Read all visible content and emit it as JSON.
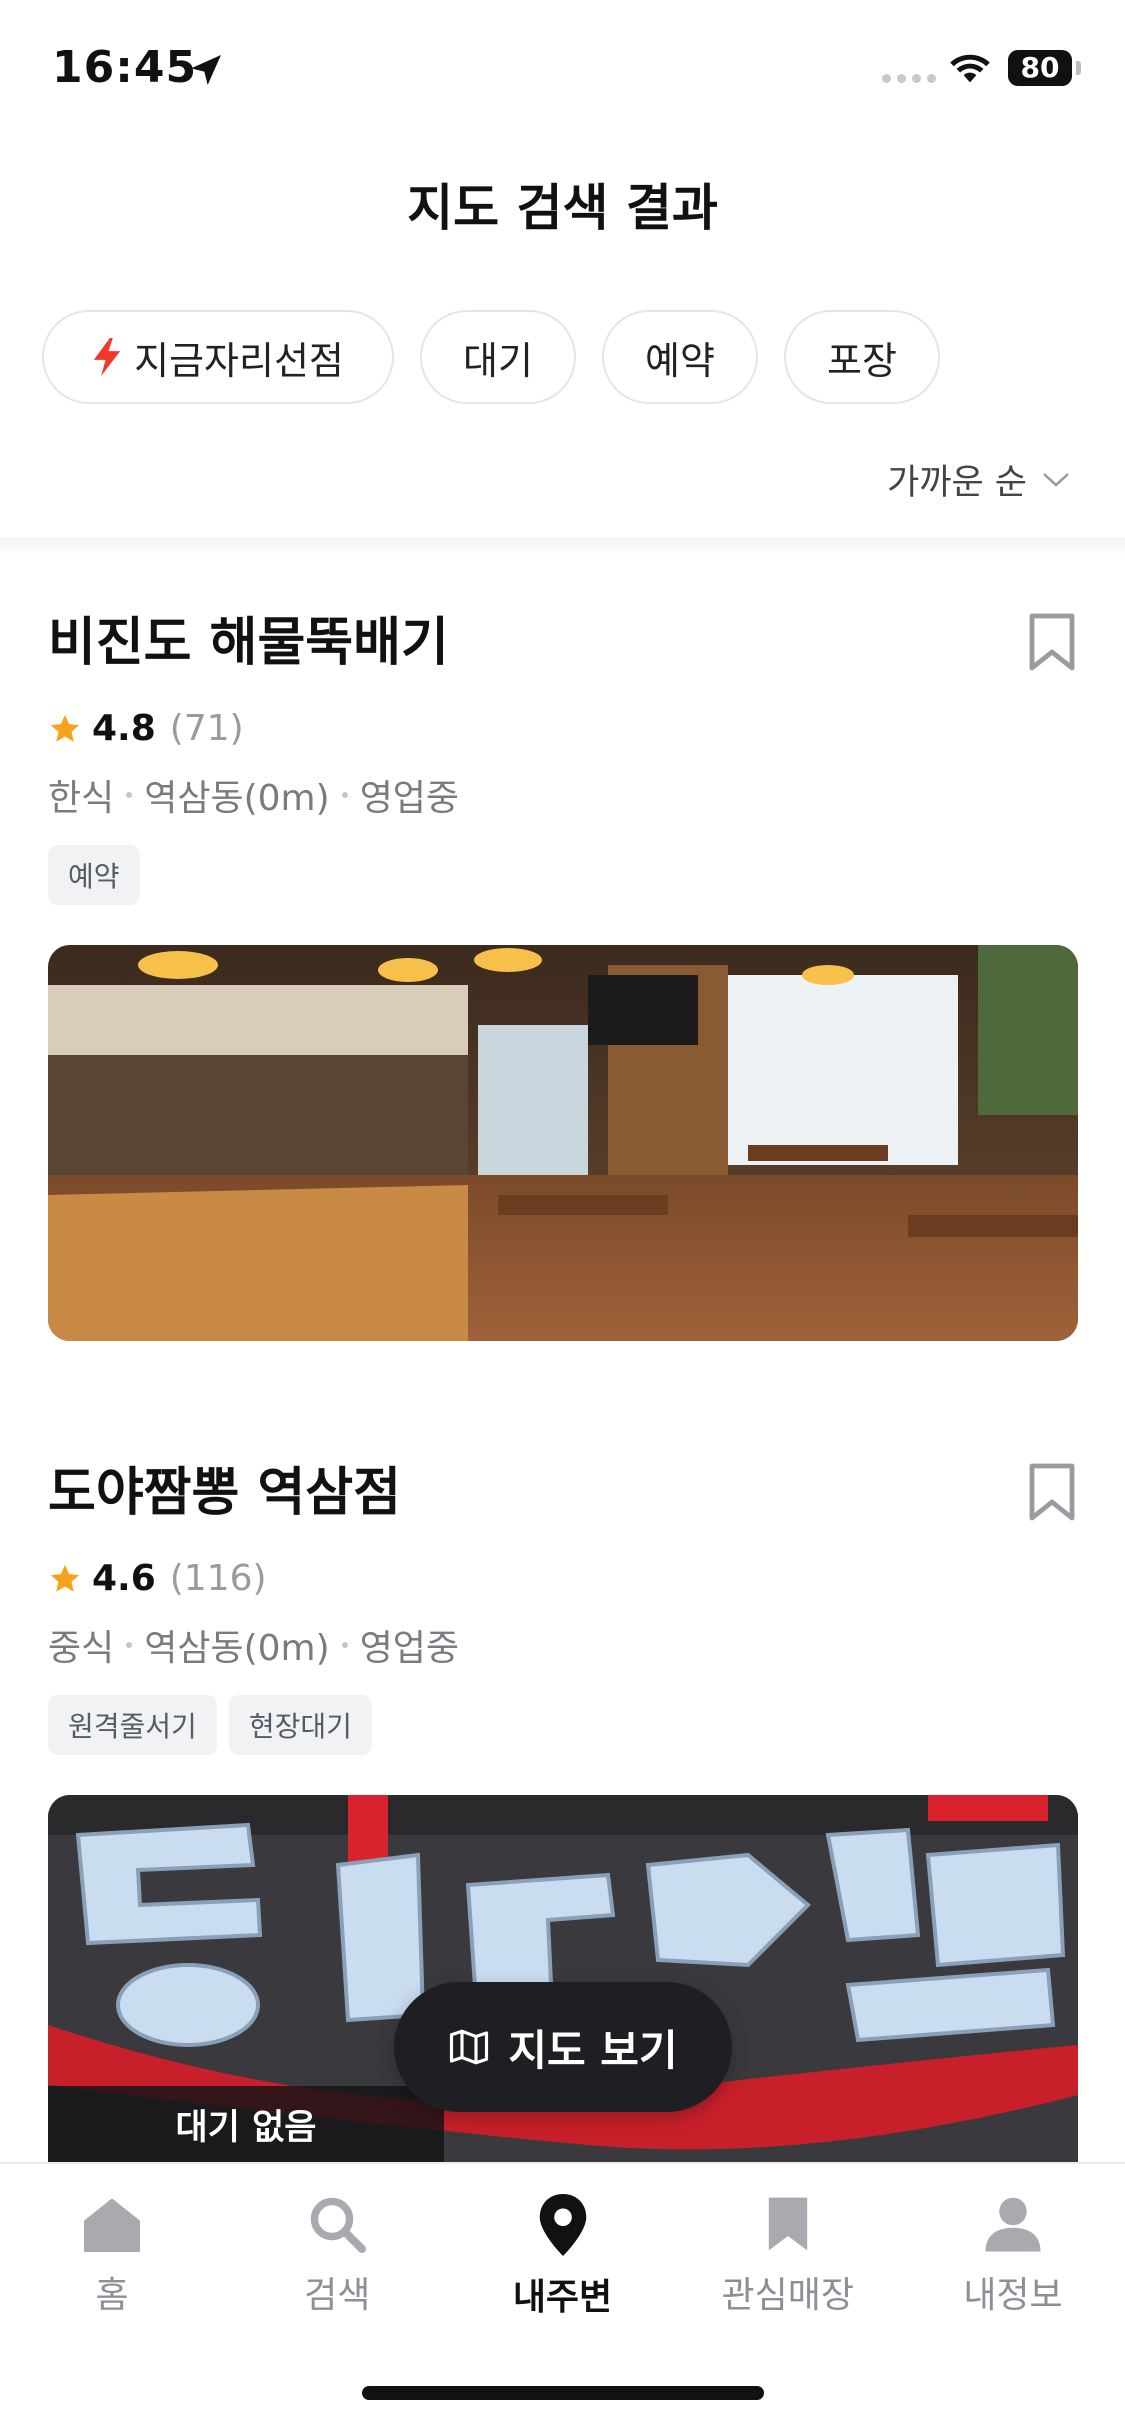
{
  "status_bar": {
    "time": "16:45",
    "battery": "80"
  },
  "header": {
    "title": "지도 검색 결과"
  },
  "filters": {
    "now_seat": "지금자리선점",
    "wait": "대기",
    "reserve": "예약",
    "pack": "포장"
  },
  "sort": {
    "label": "가까운 순"
  },
  "restaurants": [
    {
      "name": "비진도 해물뚝배기",
      "rating": "4.8",
      "review_count": "(71)",
      "category": "한식",
      "location": "역삼동(0m)",
      "status": "영업중",
      "tags": [
        "예약"
      ]
    },
    {
      "name": "도야짬뽕 역삼점",
      "rating": "4.6",
      "review_count": "(116)",
      "category": "중식",
      "location": "역삼동(0m)",
      "status": "영업중",
      "tags": [
        "원격줄서기",
        "현장대기"
      ],
      "wait_badge": "대기 없음"
    }
  ],
  "map_button": {
    "label": "지도 보기"
  },
  "bottom_nav": {
    "items": [
      {
        "label": "홈",
        "icon": "home-icon"
      },
      {
        "label": "검색",
        "icon": "search-icon"
      },
      {
        "label": "내주변",
        "icon": "location-pin-icon",
        "active": true
      },
      {
        "label": "관심매장",
        "icon": "bookmark-icon"
      },
      {
        "label": "내정보",
        "icon": "person-icon"
      }
    ]
  },
  "colors": {
    "accent_bolt": "#f2372b",
    "star": "#f7a21b",
    "tag_bg": "#f1f2f4",
    "dark_button": "#1e1f22"
  }
}
